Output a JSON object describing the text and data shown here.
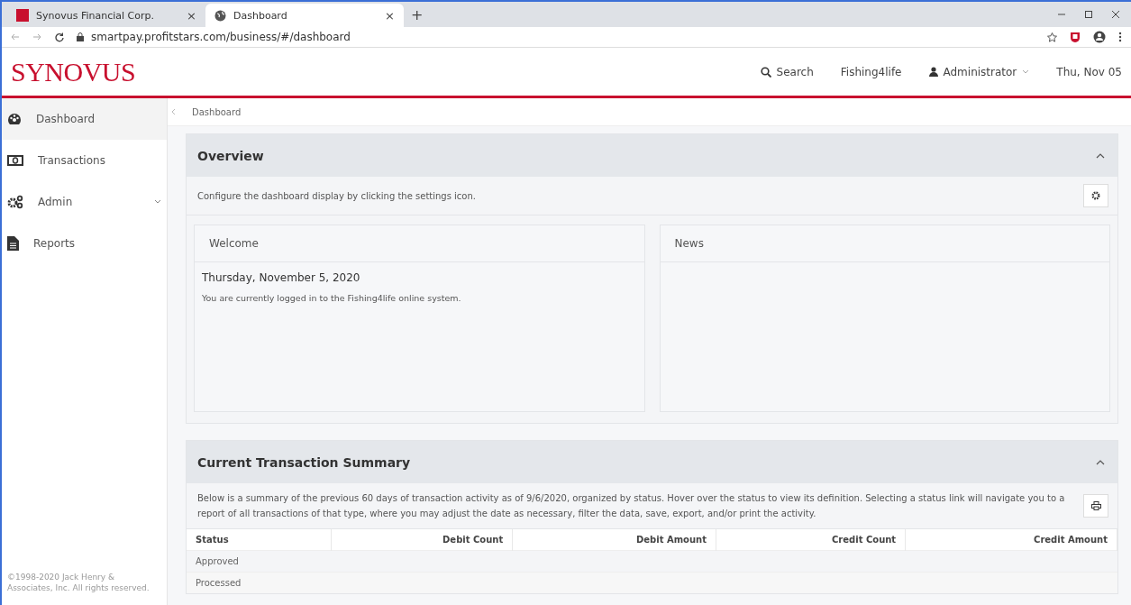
{
  "browser": {
    "tabs": [
      {
        "title": "Synovus Financial Corp.",
        "selected": false,
        "close": "×"
      },
      {
        "title": "Dashboard",
        "selected": true,
        "close": "×"
      }
    ],
    "new_tab": "+",
    "url": "smartpay.profitstars.com/business/#/dashboard"
  },
  "header": {
    "logo": "SYNOVUS",
    "search": "Search",
    "company": "Fishing4life",
    "user": "Administrator",
    "date": "Thu, Nov 05"
  },
  "sidebar": {
    "items": [
      {
        "label": "Dashboard",
        "kind": "dashboard",
        "selected": true,
        "expandable": false
      },
      {
        "label": "Transactions",
        "kind": "money",
        "selected": false,
        "expandable": false
      },
      {
        "label": "Admin",
        "kind": "gears",
        "selected": false,
        "expandable": true
      },
      {
        "label": "Reports",
        "kind": "document",
        "selected": false,
        "expandable": false
      }
    ],
    "copyright": "©1998-2020 Jack Henry & Associates, Inc. All rights reserved."
  },
  "breadcrumb": "Dashboard",
  "overview": {
    "title": "Overview",
    "expanded": true,
    "description": "Configure the dashboard display by clicking the settings icon.",
    "widgets": [
      {
        "title": "Welcome",
        "date": "Thursday, November 5, 2020",
        "message": "You are currently logged in to the Fishing4life online system."
      },
      {
        "title": "News"
      }
    ]
  },
  "summary": {
    "title": "Current Transaction Summary",
    "expanded": true,
    "description": "Below is a summary of the previous 60 days of transaction activity as of 9/6/2020, organized by status. Hover over the status to view its definition. Selecting a status link will navigate you to a report of all transactions of that type, where you may adjust the date as necessary, filter the data, save, export, and/or print the activity.",
    "table": {
      "columns": [
        "Status",
        "Debit Count",
        "Debit Amount",
        "Credit Count",
        "Credit Amount"
      ],
      "rows": [
        [
          "Approved"
        ],
        [
          "Processed"
        ]
      ]
    }
  }
}
